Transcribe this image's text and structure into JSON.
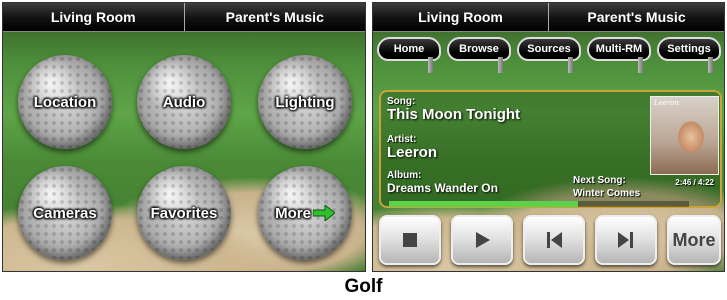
{
  "left_panel": {
    "tabs": [
      "Living Room",
      "Parent's Music"
    ],
    "buttons": [
      "Location",
      "Audio",
      "Lighting",
      "Cameras",
      "Favorites",
      "More"
    ]
  },
  "right_panel": {
    "tabs": [
      "Living Room",
      "Parent's Music"
    ],
    "nav": [
      "Home",
      "Browse",
      "Sources",
      "Multi-RM",
      "Settings"
    ],
    "now_playing": {
      "song_label": "Song:",
      "song": "This Moon Tonight",
      "artist_label": "Artist:",
      "artist": "Leeron",
      "album_label": "Album:",
      "album": "Dreams Wander On",
      "next_label": "Next Song:",
      "next_song": "Winter Comes",
      "time": "2:46 / 4:22",
      "cover_text": "Leeron",
      "progress": 0.63
    },
    "controls": {
      "more_label": "More"
    }
  },
  "caption": "Golf",
  "colors": {
    "progress": "#5bd24a",
    "panel_border": "#c9a43b"
  },
  "icons": {
    "stop": "stop-icon",
    "play": "play-icon",
    "prev": "skip-previous-icon",
    "next": "skip-next-icon",
    "more_arrow": "arrow-right-icon"
  }
}
